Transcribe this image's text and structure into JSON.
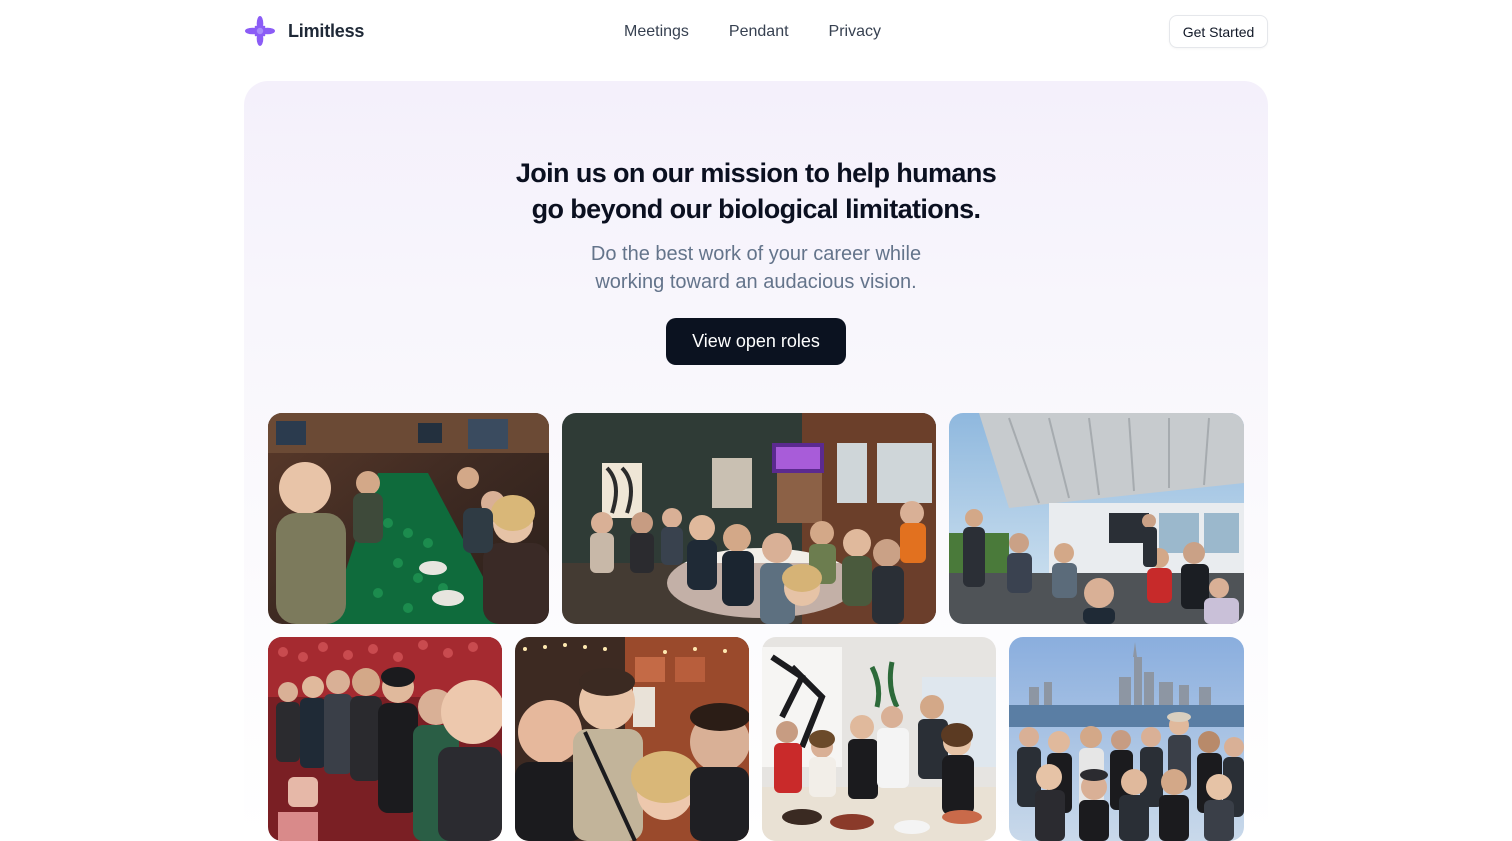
{
  "brand": {
    "name": "Limitless",
    "logo_icon": "limitless-star-logo",
    "logo_color": "#8b5cf6"
  },
  "nav": {
    "items": [
      {
        "label": "Meetings"
      },
      {
        "label": "Pendant"
      },
      {
        "label": "Privacy"
      }
    ]
  },
  "header": {
    "cta_label": "Get Started"
  },
  "hero": {
    "title_line1": "Join us on our mission to help humans",
    "title_line2": "go beyond our biological limitations.",
    "subtitle_line1": "Do the best work of your career while",
    "subtitle_line2": "working toward an audacious vision.",
    "cta_label": "View open roles",
    "background_tint": "#f4f0fb"
  },
  "photos": [
    {
      "icon": "team-dinner-photo"
    },
    {
      "icon": "team-group-dinner-photo"
    },
    {
      "icon": "team-patio-photo"
    },
    {
      "icon": "team-arena-selfie-photo"
    },
    {
      "icon": "team-bar-selfie-photo"
    },
    {
      "icon": "team-party-photo"
    },
    {
      "icon": "team-skyline-group-photo"
    }
  ],
  "colors": {
    "primary_button": "#0b1220",
    "accent": "#8b5cf6",
    "text_muted": "#64748b"
  }
}
